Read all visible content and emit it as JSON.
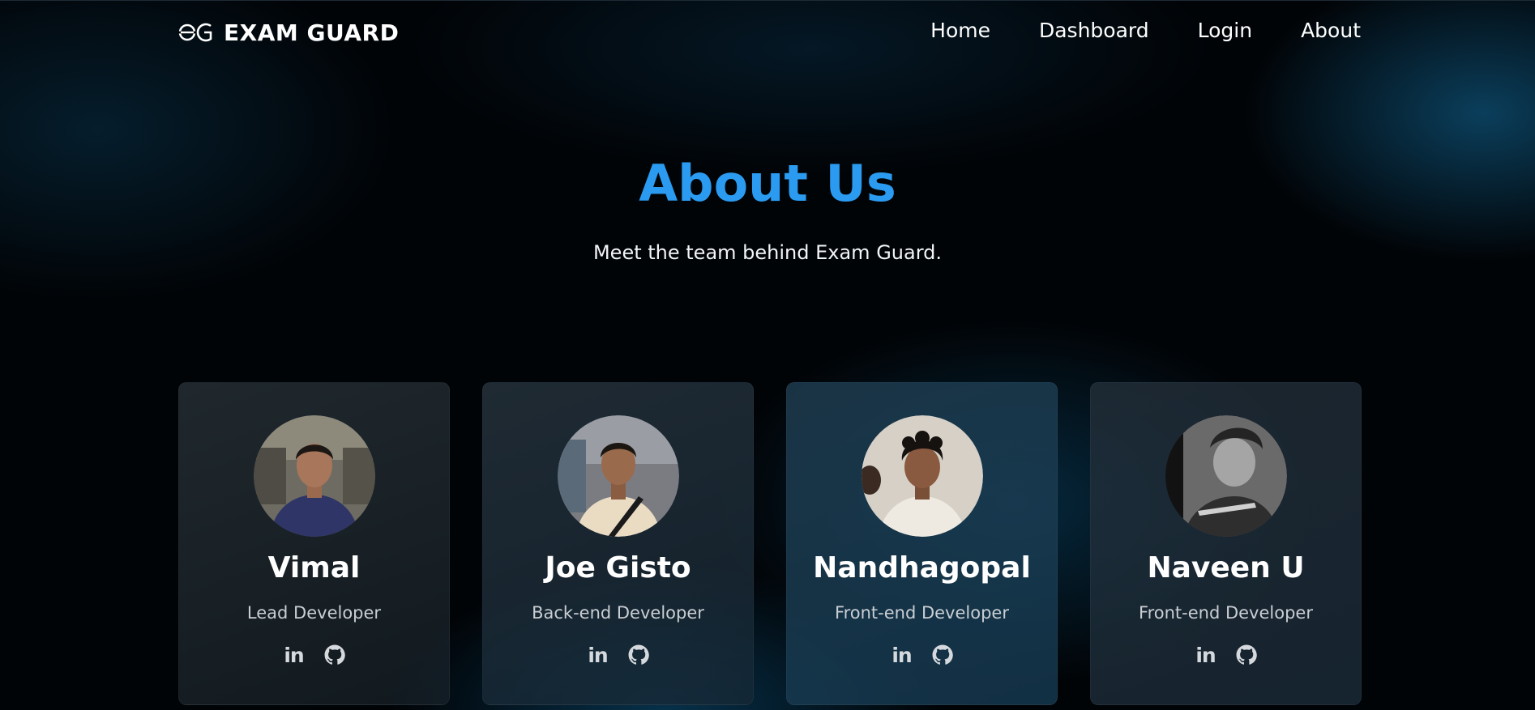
{
  "brand": {
    "logo_icon": "eg-shield-logo-icon",
    "name": "EXAM GUARD"
  },
  "nav": {
    "items": [
      {
        "label": "Home"
      },
      {
        "label": "Dashboard"
      },
      {
        "label": "Login"
      },
      {
        "label": "About"
      }
    ]
  },
  "hero": {
    "title": "About Us",
    "subtitle": "Meet the team behind Exam Guard."
  },
  "team": [
    {
      "name": "Vimal",
      "role": "Lead Developer",
      "socials": [
        "linkedin-icon",
        "github-icon"
      ]
    },
    {
      "name": "Joe Gisto",
      "role": "Back-end Developer",
      "socials": [
        "linkedin-icon",
        "github-icon"
      ]
    },
    {
      "name": "Nandhagopal",
      "role": "Front-end Developer",
      "socials": [
        "linkedin-icon",
        "github-icon"
      ]
    },
    {
      "name": "Naveen U",
      "role": "Front-end Developer",
      "socials": [
        "linkedin-icon",
        "github-icon"
      ]
    }
  ],
  "colors": {
    "accent": "#2a9bf0",
    "background": "#010407",
    "card": "#1e2a33",
    "role_text": "#c9ced3"
  }
}
